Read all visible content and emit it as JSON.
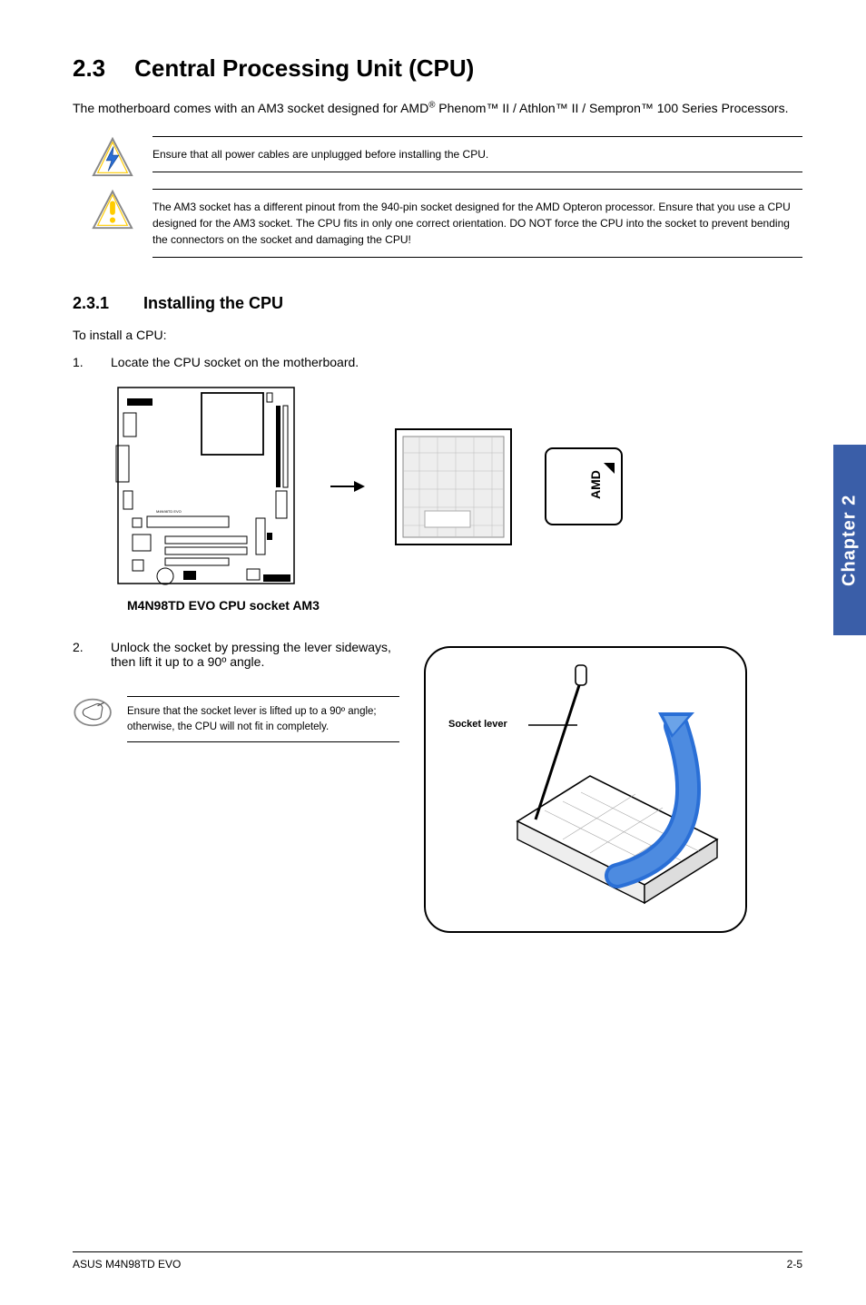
{
  "section": {
    "number": "2.3",
    "title": "Central Processing Unit (CPU)"
  },
  "intro": {
    "part1": "The motherboard comes with an AM3 socket designed for AMD",
    "reg": "®",
    "part2": " Phenom™ II / Athlon™ II / Sempron™ 100 Series Processors."
  },
  "callout1": "Ensure that all power cables are unplugged before installing the CPU.",
  "callout2": "The AM3 socket has a different pinout from the 940-pin socket designed for the AMD Opteron processor. Ensure that you use a CPU designed for the AM3 socket. The CPU fits in only one correct orientation. DO NOT force the CPU into the socket to prevent bending the connectors on the socket and damaging the CPU!",
  "subsection": {
    "number": "2.3.1",
    "title": "Installing the CPU"
  },
  "preStep": "To install a CPU:",
  "step1": {
    "num": "1.",
    "text": "Locate the CPU socket on the motherboard."
  },
  "boardCaption": "M4N98TD EVO CPU socket AM3",
  "step2": {
    "num": "2.",
    "text": "Unlock the socket by pressing the lever sideways, then lift it up to a 90º angle."
  },
  "note2": "Ensure that the socket lever is lifted up to a 90º angle; otherwise, the CPU will not fit in completely.",
  "socketLeverLabel": "Socket lever",
  "chapterTab": "Chapter 2",
  "footer": {
    "left": "ASUS M4N98TD EVO",
    "right": "2-5"
  },
  "icons": {
    "warning": "warning-triangle-icon",
    "caution": "caution-triangle-icon",
    "note": "note-hand-icon",
    "arrow": "arrow-right-icon",
    "amd": "amd-logo-icon"
  }
}
